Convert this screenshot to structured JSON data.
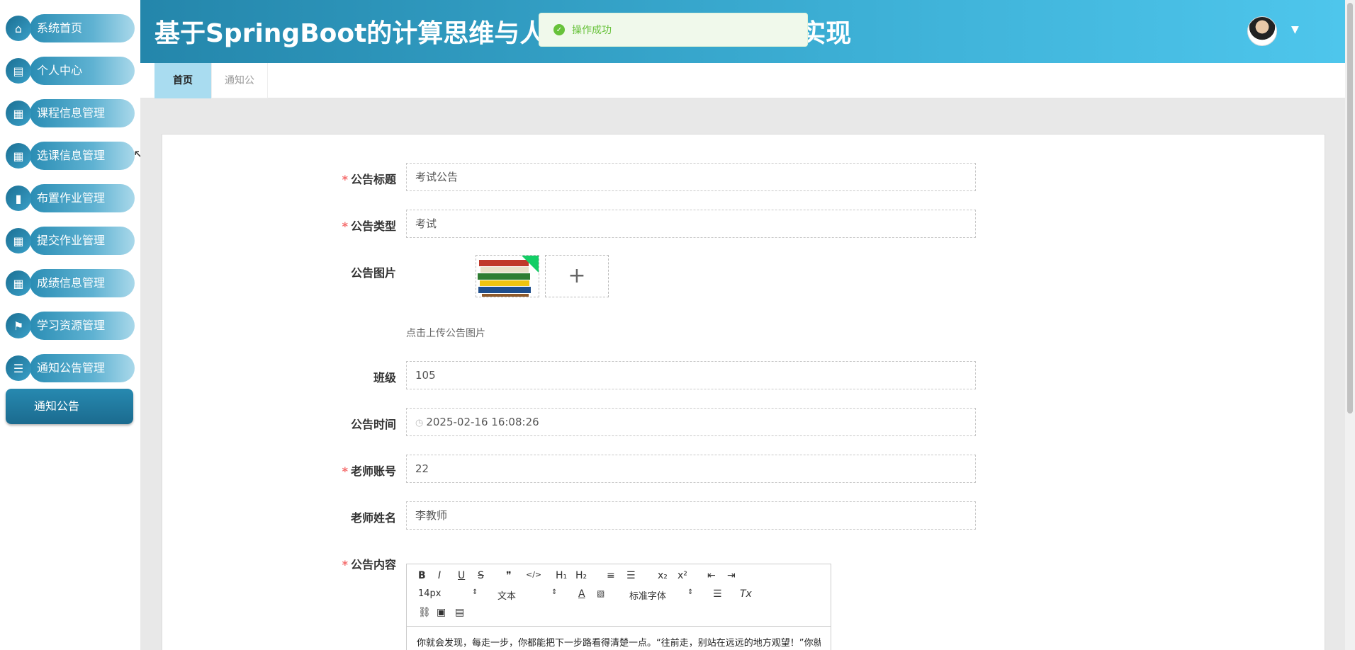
{
  "sidebar": {
    "items": [
      {
        "label": "系统首页",
        "icon": "home-icon"
      },
      {
        "label": "个人中心",
        "icon": "profile-icon"
      },
      {
        "label": "课程信息管理",
        "icon": "grid-icon"
      },
      {
        "label": "选课信息管理",
        "icon": "grid-icon"
      },
      {
        "label": "布置作业管理",
        "icon": "books-icon"
      },
      {
        "label": "提交作业管理",
        "icon": "grid-icon"
      },
      {
        "label": "成绩信息管理",
        "icon": "grid-icon"
      },
      {
        "label": "学习资源管理",
        "icon": "flag-icon"
      },
      {
        "label": "通知公告管理",
        "icon": "list-icon"
      }
    ],
    "submenu_label": "通知公告"
  },
  "header": {
    "title": "基于SpringBoot的计算思维与人工智能教学平台设计与实现"
  },
  "toast": {
    "message": "操作成功"
  },
  "tabs": [
    {
      "label": "首页",
      "active": true
    },
    {
      "label": "通知公告",
      "active": false
    }
  ],
  "form": {
    "title": {
      "label": "公告标题",
      "value": "考试公告",
      "required": true
    },
    "type": {
      "label": "公告类型",
      "value": "考试",
      "required": true
    },
    "image": {
      "label": "公告图片",
      "tip": "点击上传公告图片",
      "plus": "+"
    },
    "class": {
      "label": "班级",
      "value": "105"
    },
    "time": {
      "label": "公告时间",
      "value": "2025-02-16 16:08:26"
    },
    "teacher_account": {
      "label": "老师账号",
      "value": "22",
      "required": true
    },
    "teacher_name": {
      "label": "老师姓名",
      "value": "李教师"
    },
    "content": {
      "label": "公告内容",
      "required": true,
      "text": "你就会发现，每走一步，你都能把下一步路看得清楚一点。“往前走，别站在远远的地方观望！”你就"
    },
    "required_mark": "*"
  },
  "editor": {
    "font_size": "14px",
    "text_style": "文本",
    "font_family": "标准字体",
    "buttons": [
      "B",
      "I",
      "U",
      "S",
      "❞",
      "</>",
      "H₁",
      "H₂",
      "≡",
      "☰",
      "x₂",
      "x²",
      "⇤",
      "⇥"
    ],
    "color_button": "A"
  },
  "colors": {
    "header_start": "#2486ab",
    "header_end": "#4ec6ec",
    "toast_green": "#67c23a",
    "required_red": "#f56c6c",
    "active_tab": "#a9dcf0"
  }
}
